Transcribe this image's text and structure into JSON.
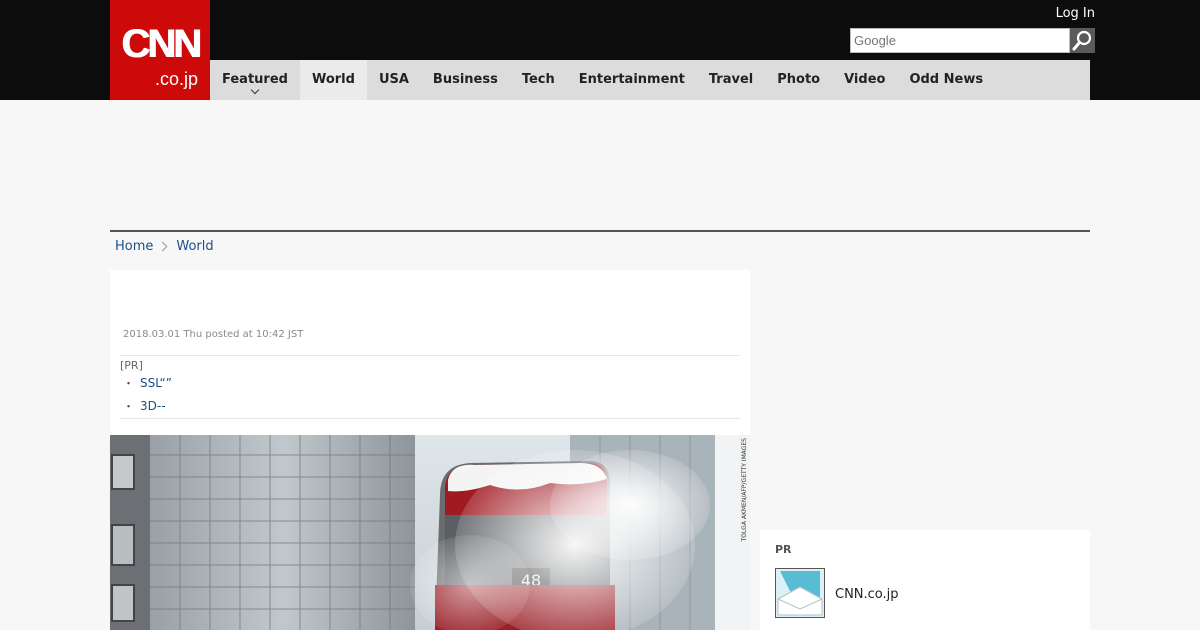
{
  "header": {
    "logo_main": "CNN",
    "logo_sub": ".co.jp",
    "login_label": "Log In",
    "search": {
      "placeholder": "Google"
    }
  },
  "nav": {
    "items": [
      {
        "label": "Featured"
      },
      {
        "label": "World"
      },
      {
        "label": "USA"
      },
      {
        "label": "Business"
      },
      {
        "label": "Tech"
      },
      {
        "label": "Entertainment"
      },
      {
        "label": "Travel"
      },
      {
        "label": "Photo"
      },
      {
        "label": "Video"
      },
      {
        "label": "Odd News"
      }
    ],
    "active": "World"
  },
  "breadcrumb": {
    "home": "Home",
    "current": "World"
  },
  "article": {
    "date": "2018.03.01 Thu posted at 10:42 JST",
    "pr": {
      "label": "[PR]",
      "bullet": "・",
      "links": [
        "SSL“”",
        "3D--"
      ]
    },
    "photo_credit": "TOLGA AKMEN/AFP/GETTY IMAGES"
  },
  "sidebar_pr": {
    "label": "PR",
    "item_name": "CNN.co.jp"
  },
  "icons": {
    "search": "search-icon",
    "caret": "chevron-down-icon",
    "separator": "chevron-right-icon"
  },
  "colors": {
    "brand_red": "#cc0a0a",
    "header_bg": "#0c0c0c",
    "nav_bg": "#dcdcdc",
    "link": "#1c4f8a"
  }
}
